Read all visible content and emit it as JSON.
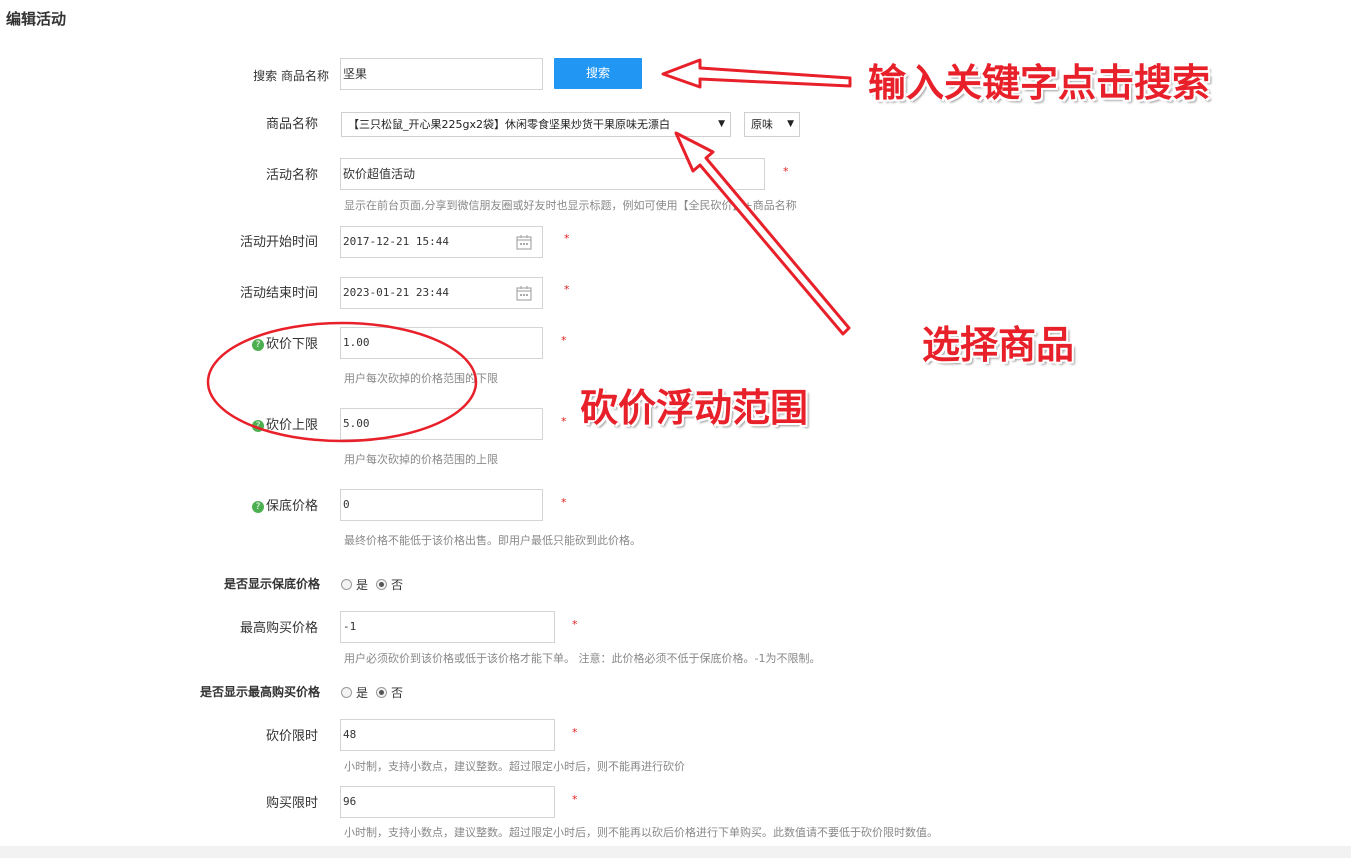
{
  "page_title": "编辑活动",
  "search": {
    "label": "搜索 商品名称",
    "value": "坚果",
    "button": "搜索"
  },
  "product": {
    "label": "商品名称",
    "selected": "【三只松鼠_开心果225gx2袋】休闲零食坚果炒货干果原味无漂白",
    "variant": "原味"
  },
  "activity_name": {
    "label": "活动名称",
    "value": "砍价超值活动",
    "hint": "显示在前台页面,分享到微信朋友圈或好友时也显示标题，例如可使用【全民砍价】+商品名称"
  },
  "start_time": {
    "label": "活动开始时间",
    "value": "2017-12-21 15:44"
  },
  "end_time": {
    "label": "活动结束时间",
    "value": "2023-01-21 23:44"
  },
  "min_cut": {
    "label": "砍价下限",
    "value": "1.00",
    "hint": "用户每次砍掉的价格范围的下限"
  },
  "max_cut": {
    "label": "砍价上限",
    "value": "5.00",
    "hint": "用户每次砍掉的价格范围的上限"
  },
  "floor_price": {
    "label": "保底价格",
    "value": "0",
    "hint": "最终价格不能低于该价格出售。即用户最低只能砍到此价格。"
  },
  "show_floor": {
    "label": "是否显示保底价格",
    "yes": "是",
    "no": "否",
    "selected": "no"
  },
  "max_buy_price": {
    "label": "最高购买价格",
    "value": "-1",
    "hint": "用户必须砍价到该价格或低于该价格才能下单。 注意：此价格必须不低于保底价格。-1为不限制。"
  },
  "show_max_buy": {
    "label": "是否显示最高购买价格",
    "yes": "是",
    "no": "否",
    "selected": "no"
  },
  "cut_limit": {
    "label": "砍价限时",
    "value": "48",
    "hint": "小时制，支持小数点，建议整数。超过限定小时后，则不能再进行砍价"
  },
  "buy_limit": {
    "label": "购买限时",
    "value": "96",
    "hint": "小时制，支持小数点，建议整数。超过限定小时后，则不能再以砍后价格进行下单购买。此数值请不要低于砍价限时数值。"
  },
  "required_mark": "*",
  "help_glyph": "?",
  "annotations": {
    "search_tip": "输入关键字点击搜索",
    "select_tip": "选择商品",
    "range_tip": "砍价浮动范围"
  },
  "colors": {
    "primary_button": "#2196f3",
    "annotation_red": "#e8202a",
    "help_green": "#4caf50"
  }
}
